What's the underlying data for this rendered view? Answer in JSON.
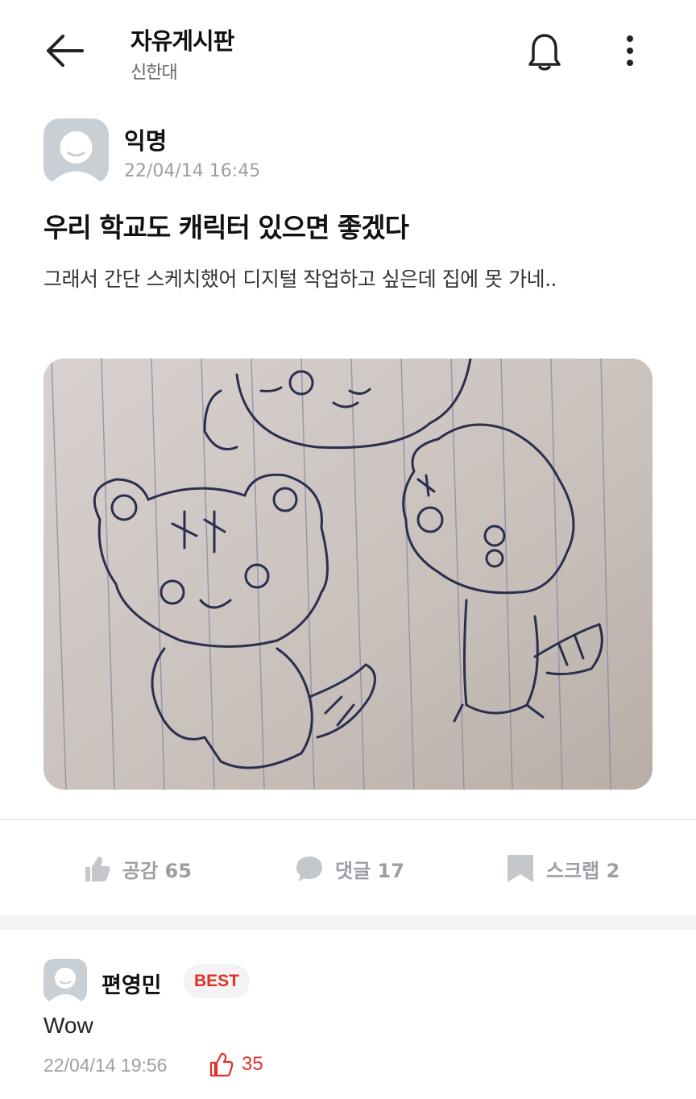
{
  "header": {
    "title": "자유게시판",
    "subtitle": "신한대",
    "back_icon": "back-arrow-icon",
    "bell_icon": "bell-icon",
    "more_icon": "more-vertical-icon"
  },
  "post": {
    "author": "익명",
    "date": "22/04/14 16:45",
    "title": "우리 학교도 캐릭터 있으면 좋겠다",
    "body": "그래서 간단 스케치했어 디지털 작업하고 싶은데 집에 못 가네..",
    "image_icon": "sketch-photo"
  },
  "actions": {
    "like_label": "공감 65",
    "comment_label": "댓글 17",
    "scrap_label": "스크랩 2"
  },
  "comment": {
    "author": "편영민",
    "badge": "BEST",
    "text": "Wow",
    "date": "22/04/14 19:56",
    "likes": "35"
  },
  "colors": {
    "accent": "#e0302a",
    "muted": "#9aa0a6",
    "avatar_bg": "#c8cfd5"
  }
}
